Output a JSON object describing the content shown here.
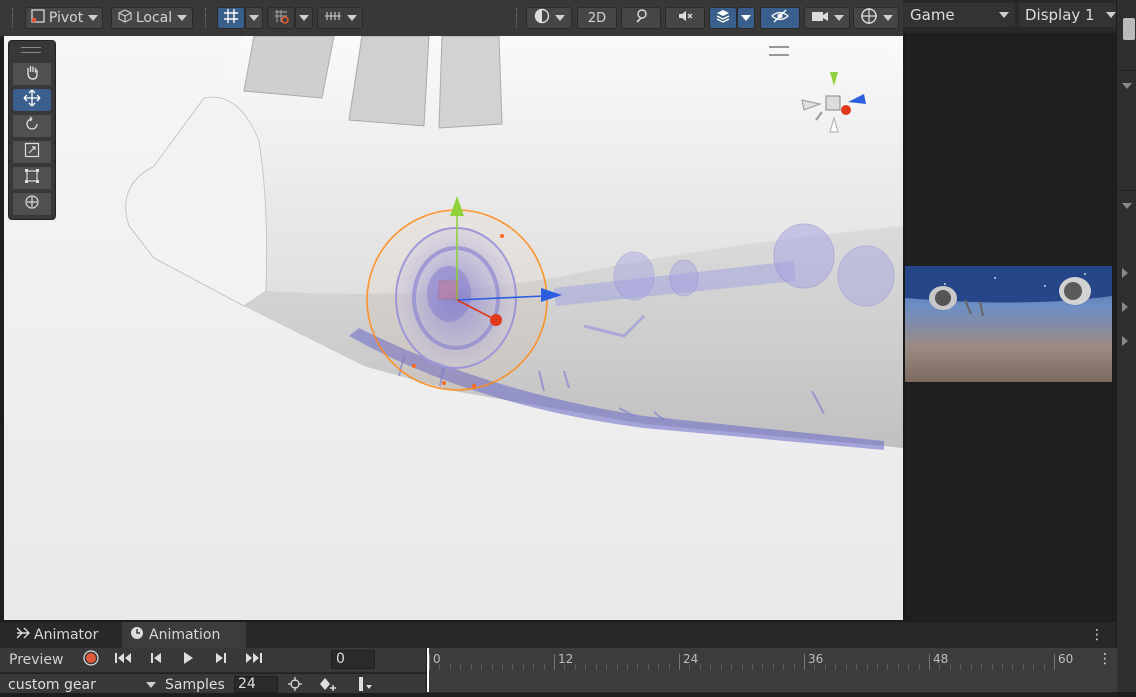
{
  "scene_toolbar": {
    "pivot_label": "Pivot",
    "local_label": "Local",
    "twod_label": "2D"
  },
  "game_panel": {
    "tab_label": "Game",
    "display_label": "Display 1"
  },
  "anim_panel": {
    "tabs": [
      {
        "label": "Animator"
      },
      {
        "label": "Animation"
      }
    ],
    "preview_label": "Preview",
    "frame_value": "0",
    "clip_name": "custom gear",
    "samples_label": "Samples",
    "samples_value": "24",
    "timeline_ticks": [
      "0",
      "12",
      "24",
      "36",
      "48",
      "60"
    ]
  },
  "colors": {
    "accent": "#3a5f8c",
    "record": "#e05a3a",
    "gizmo_y": "#8ed13a",
    "gizmo_z": "#2b5fe0",
    "gizmo_x": "#e03a1a",
    "rotation_ring": "#ff8c1a"
  }
}
